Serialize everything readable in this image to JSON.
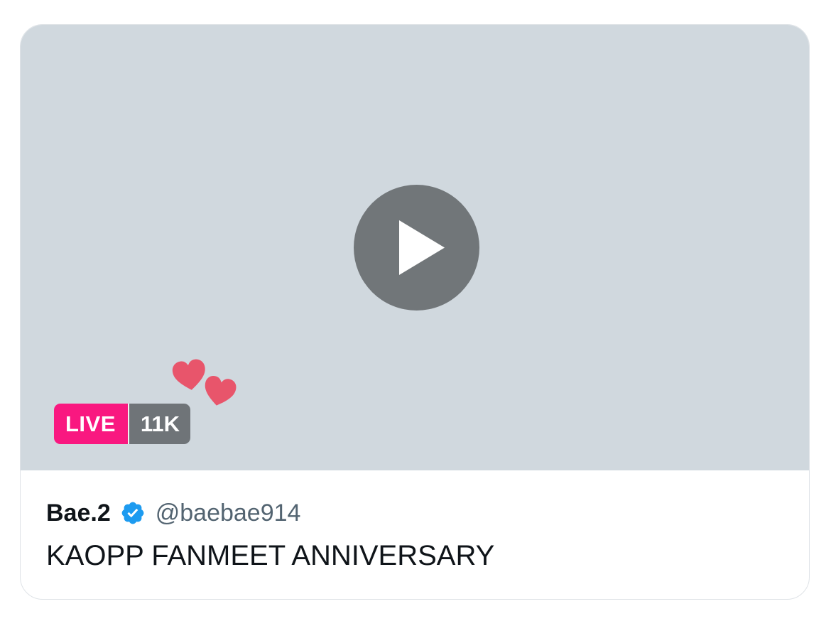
{
  "media": {
    "live_label": "LIVE",
    "viewer_count": "11K"
  },
  "broadcast": {
    "display_name": "Bae.2",
    "handle": "@baebae914",
    "title": "KAOPP FANMEET ANNIVERSARY"
  },
  "icons": {
    "play": "play-icon",
    "verified": "verified-badge-icon",
    "hearts": "heart-icon"
  },
  "colors": {
    "live_badge": "#f91880",
    "viewer_badge": "#6f7478",
    "media_background": "#d0d8de",
    "play_button": "#717679",
    "verified": "#1d9bf0",
    "heart": "#e8556b"
  }
}
